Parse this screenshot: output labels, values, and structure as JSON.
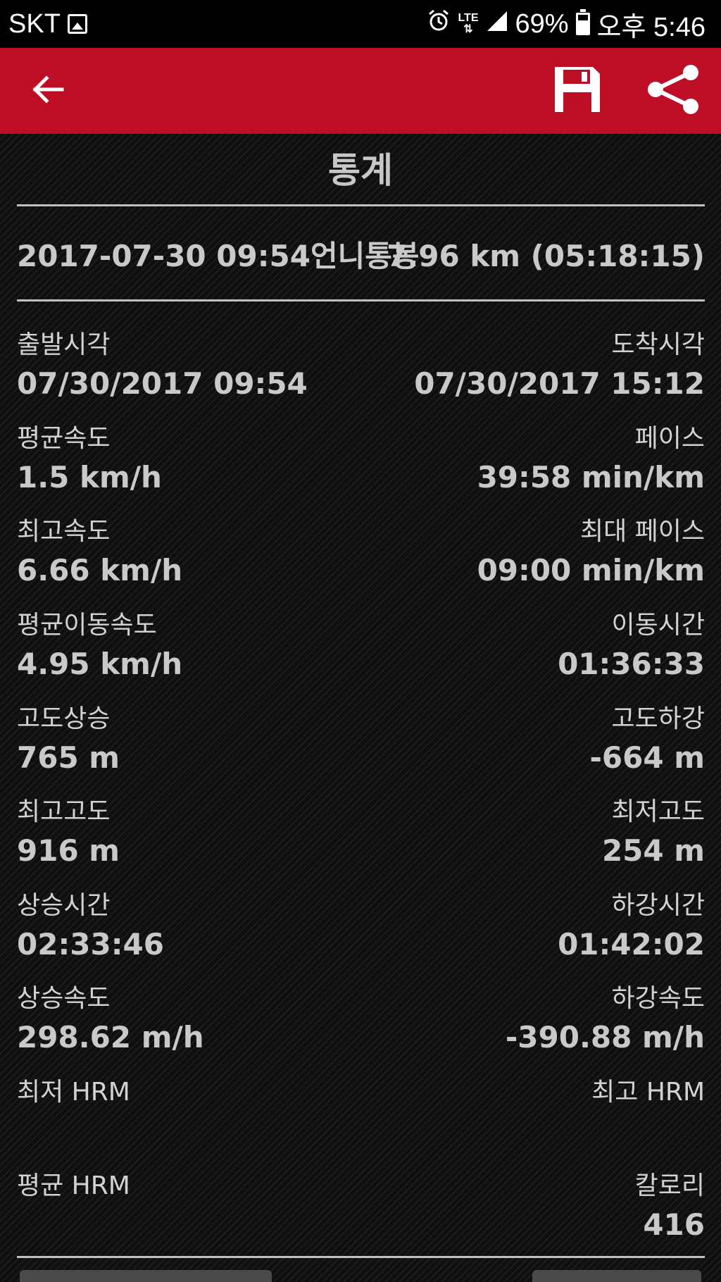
{
  "status_bar": {
    "carrier": "SKT",
    "network": "LTE",
    "battery": "69%",
    "time": "오후 5:46"
  },
  "app_bar": {
    "background_color": "#bd0e26",
    "icons": [
      "back-arrow-icon",
      "save-icon",
      "share-icon"
    ]
  },
  "page": {
    "title": "통계"
  },
  "summary": {
    "activity": "2017-07-30 09:54언니통봉",
    "distance_time": "7.96 km (05:18:15)"
  },
  "stats": [
    {
      "left": {
        "label": "출발시각",
        "value": "07/30/2017 09:54"
      },
      "right": {
        "label": "도착시각",
        "value": "07/30/2017 15:12"
      }
    },
    {
      "left": {
        "label": "평균속도",
        "value": "1.5 km/h"
      },
      "right": {
        "label": "페이스",
        "value": "39:58 min/km"
      }
    },
    {
      "left": {
        "label": "최고속도",
        "value": "6.66 km/h"
      },
      "right": {
        "label": "최대 페이스",
        "value": "09:00 min/km"
      }
    },
    {
      "left": {
        "label": "평균이동속도",
        "value": "4.95 km/h"
      },
      "right": {
        "label": "이동시간",
        "value": "01:36:33"
      }
    },
    {
      "left": {
        "label": "고도상승",
        "value": "765 m"
      },
      "right": {
        "label": "고도하강",
        "value": "-664 m"
      }
    },
    {
      "left": {
        "label": "최고고도",
        "value": "916 m"
      },
      "right": {
        "label": "최저고도",
        "value": "254 m"
      }
    },
    {
      "left": {
        "label": "상승시간",
        "value": "02:33:46"
      },
      "right": {
        "label": "하강시간",
        "value": "01:42:02"
      }
    },
    {
      "left": {
        "label": "상승속도",
        "value": "298.62 m/h"
      },
      "right": {
        "label": "하강속도",
        "value": "-390.88 m/h"
      }
    },
    {
      "left": {
        "label": "최저 HRM",
        "value": ""
      },
      "right": {
        "label": "최고 HRM",
        "value": ""
      }
    },
    {
      "left": {
        "label": "평균 HRM",
        "value": ""
      },
      "right": {
        "label": "칼로리",
        "value": "416"
      }
    }
  ]
}
